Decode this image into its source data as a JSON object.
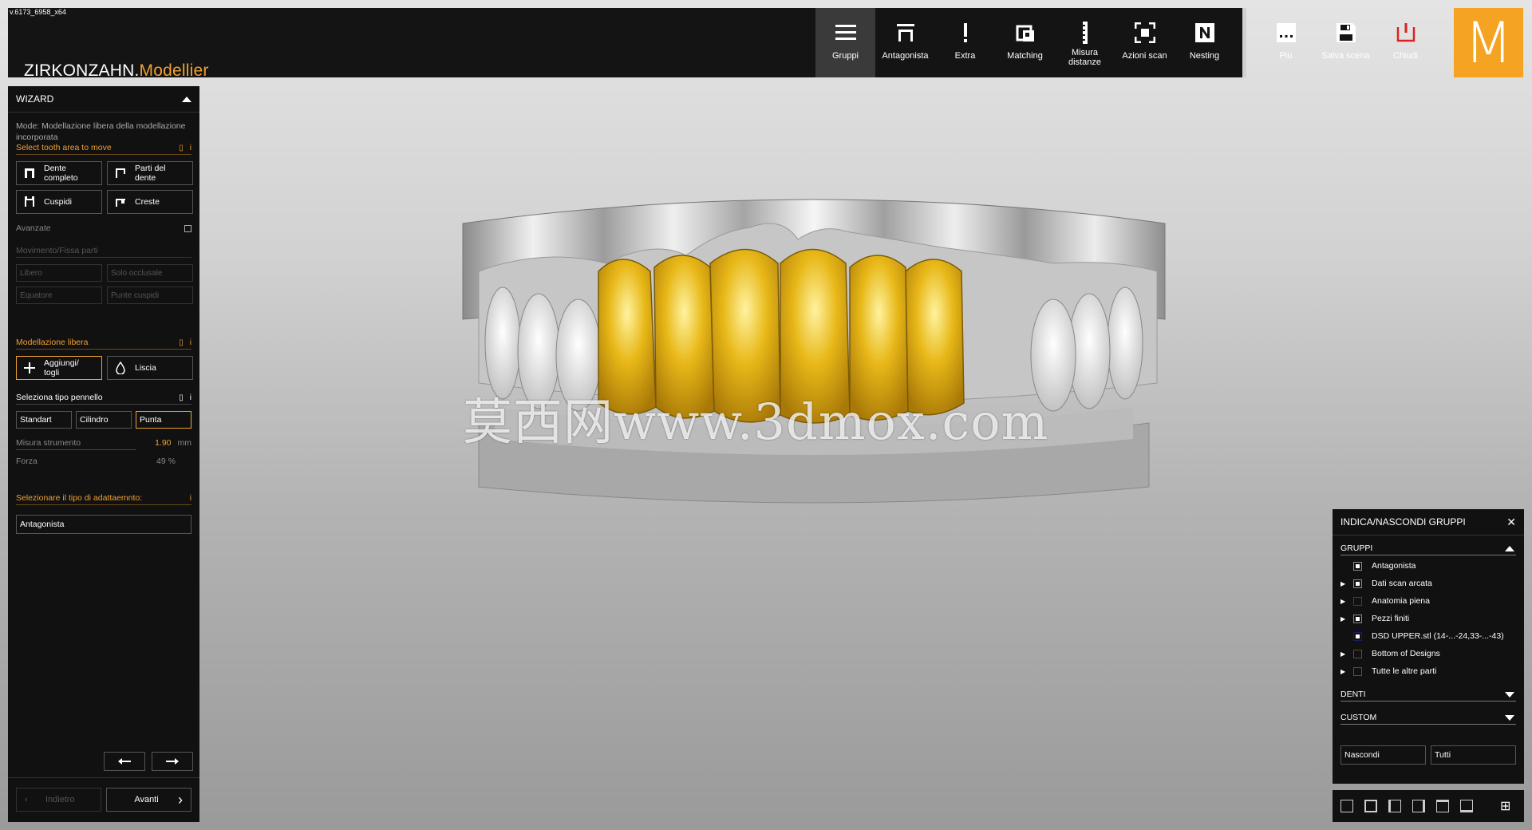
{
  "version": "v.6173_6958_x64",
  "brand": {
    "main": "ZIRKONZAHN.",
    "accent": "Modellier"
  },
  "toolbar": {
    "main": [
      {
        "label": "Gruppi",
        "icon": "menu-icon"
      },
      {
        "label": "Antagonista",
        "icon": "antagonist-icon"
      },
      {
        "label": "Extra",
        "icon": "exclamation-icon"
      },
      {
        "label": "Matching",
        "icon": "matching-icon"
      },
      {
        "label": "Misura distanze",
        "icon": "ruler-icon"
      },
      {
        "label": "Azioni scan",
        "icon": "scan-icon"
      },
      {
        "label": "Nesting",
        "icon": "nesting-icon"
      }
    ],
    "more": {
      "label": "Più",
      "icon": "more-icon"
    },
    "save": {
      "label": "Salva scena",
      "icon": "save-icon"
    },
    "close": {
      "label": "Chiudi",
      "icon": "power-icon",
      "color": "#e02020"
    },
    "logo": "M",
    "active_color": "#3a3a3a"
  },
  "wizard": {
    "title": "WIZARD",
    "mode_text": "Mode: Modellazione libera della modellazione incorporata",
    "select_area_title": "Select tooth area to move",
    "area_buttons": [
      "Dente completo",
      "Parti del dente",
      "Cuspidi",
      "Creste"
    ],
    "advanced_label": "Avanzate",
    "movement_label": "Movimento/Fissa parti",
    "movement_buttons": [
      "Libero",
      "Solo occlusale",
      "Equatore",
      "Punte cuspidi"
    ],
    "free_modelling_title": "Modellazione libera",
    "free_buttons": [
      "Aggiungi/ togli",
      "Liscia"
    ],
    "brush_title": "Seleziona tipo pennello",
    "brush_buttons": [
      "Standart",
      "Cilindro",
      "Punta"
    ],
    "tool_size_label": "Misura strumento",
    "tool_size_value": "1.90",
    "tool_size_unit": "mm",
    "force_label": "Forza",
    "force_value": "49",
    "force_unit": "%",
    "adapt_title": "Selezionare il tipo di adattaemnto:",
    "adapt_value": "Antagonista",
    "back_label": "Indietro",
    "next_label": "Avanti",
    "accent_color": "#f0a030"
  },
  "groups_panel": {
    "title": "INDICA/NASCONDI GRUPPI",
    "groups_section": "GRUPPI",
    "items": [
      {
        "label": "Antagonista",
        "expandable": false,
        "checked": true
      },
      {
        "label": "Dati scan arcata",
        "expandable": true,
        "checked": true
      },
      {
        "label": "Anatomia piena",
        "expandable": true,
        "checked": false
      },
      {
        "label": "Pezzi finiti",
        "expandable": true,
        "checked": true
      },
      {
        "label": "DSD UPPER.stl (14-...-24,33-...-43)",
        "expandable": false,
        "checked": true
      },
      {
        "label": "Bottom of Designs",
        "expandable": true,
        "checked": false
      },
      {
        "label": "Tutte le altre parti",
        "expandable": true,
        "checked": false
      }
    ],
    "denti_section": "DENTI",
    "custom_section": "CUSTOM",
    "hide_button": "Nascondi",
    "all_button": "Tutti"
  },
  "watermark": "莫西网www.3dmox.com",
  "model_colors": {
    "crown": "#e8b818",
    "stone": "#c8c8c8"
  }
}
